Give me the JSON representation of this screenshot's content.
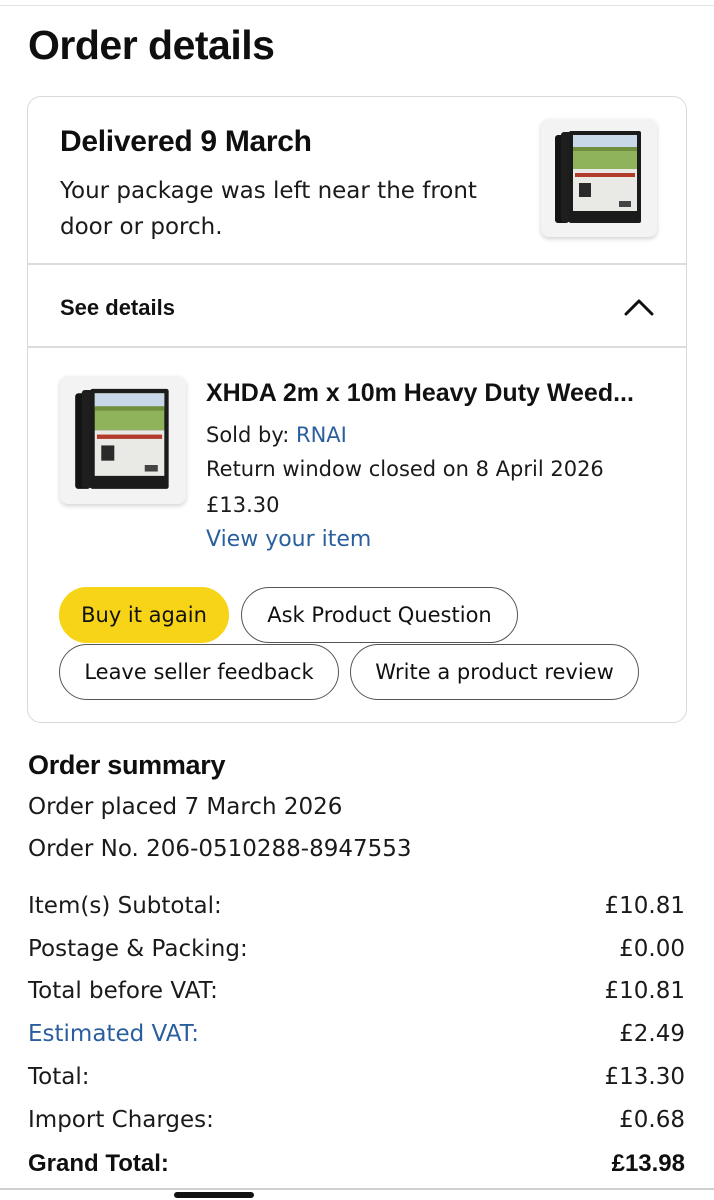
{
  "page": {
    "title": "Order details"
  },
  "delivery": {
    "title": "Delivered 9 March",
    "message": "Your package was left near the front door or porch.",
    "see_details_label": "See details"
  },
  "item": {
    "title": "XHDA 2m x 10m Heavy Duty Weed...",
    "sold_by_label": "Sold by: ",
    "seller": "RNAI",
    "return_window": "Return window closed on 8 April 2026",
    "price": "£13.30",
    "view_link": "View your item"
  },
  "actions": {
    "buy_again": "Buy it again",
    "ask_question": "Ask Product Question",
    "leave_feedback": "Leave seller feedback",
    "write_review": "Write a product review"
  },
  "summary": {
    "title": "Order summary",
    "placed": "Order placed 7 March 2026",
    "order_no": "Order No. 206-0510288-8947553",
    "rows": [
      {
        "label": "Item(s) Subtotal:",
        "value": "£10.81"
      },
      {
        "label": "Postage & Packing:",
        "value": "£0.00"
      },
      {
        "label": "Total before VAT:",
        "value": "£10.81"
      },
      {
        "label": "Estimated VAT:",
        "value": "£2.49"
      },
      {
        "label": "Total:",
        "value": "£13.30"
      },
      {
        "label": "Import Charges:",
        "value": "£0.68"
      },
      {
        "label": "Grand Total:",
        "value": "£13.98"
      }
    ]
  },
  "icons": {
    "collapse": "chevron-up-icon",
    "product": "product-thumbnail"
  },
  "colors": {
    "accent_button": "#f7d417",
    "link": "#2a5f9e"
  }
}
